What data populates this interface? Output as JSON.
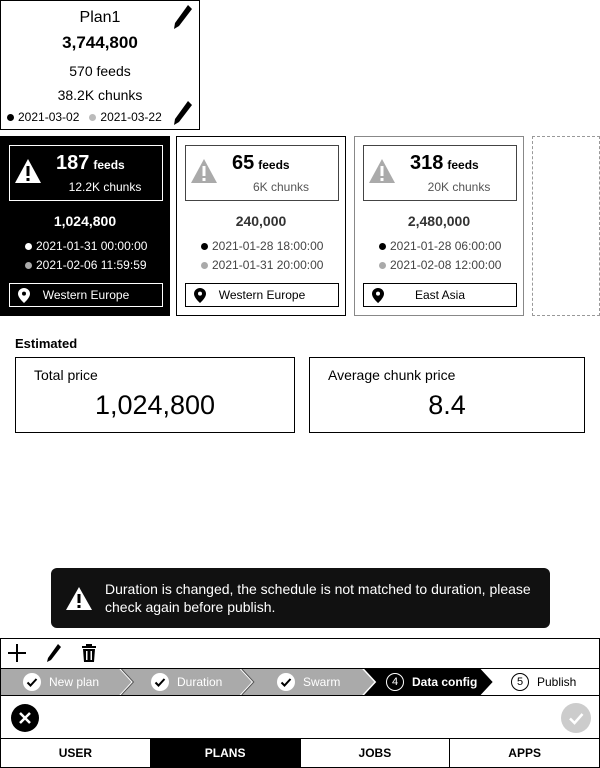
{
  "plan": {
    "title": "Plan1",
    "total": "3,744,800",
    "feeds": "570 feeds",
    "chunks": "38.2K chunks",
    "start_date": "2021-03-02",
    "end_date": "2021-03-22"
  },
  "swarms": [
    {
      "feeds_num": "187",
      "feeds_label": "feeds",
      "chunks": "12.2K chunks",
      "price": "1,024,800",
      "start": "2021-01-31 00:00:00",
      "end": "2021-02-06 11:59:59",
      "location": "Western Europe"
    },
    {
      "feeds_num": "65",
      "feeds_label": "feeds",
      "chunks": "6K chunks",
      "price": "240,000",
      "start": "2021-01-28 18:00:00",
      "end": "2021-01-31 20:00:00",
      "location": "Western Europe"
    },
    {
      "feeds_num": "318",
      "feeds_label": "feeds",
      "chunks": "20K chunks",
      "price": "2,480,000",
      "start": "2021-01-28 06:00:00",
      "end": "2021-02-08 12:00:00",
      "location": "East Asia"
    }
  ],
  "estimated": {
    "label": "Estimated",
    "total_label": "Total price",
    "total_value": "1,024,800",
    "avg_label": "Average chunk price",
    "avg_value": "8.4"
  },
  "toast": {
    "message": "Duration is changed, the schedule is not matched to duration, please check again before publish."
  },
  "stepper": {
    "steps": [
      {
        "label": "New plan",
        "state": "done"
      },
      {
        "label": "Duration",
        "state": "done"
      },
      {
        "label": "Swarm",
        "state": "done"
      },
      {
        "label": "Data config",
        "number": "4",
        "state": "active"
      },
      {
        "label": "Publish",
        "number": "5",
        "state": "todo"
      }
    ]
  },
  "tabs": [
    "USER",
    "PLANS",
    "JOBS",
    "APPS"
  ],
  "colors": {
    "active": "#000000",
    "done": "#aaaaaa",
    "ok_disabled": "#cccccc"
  }
}
